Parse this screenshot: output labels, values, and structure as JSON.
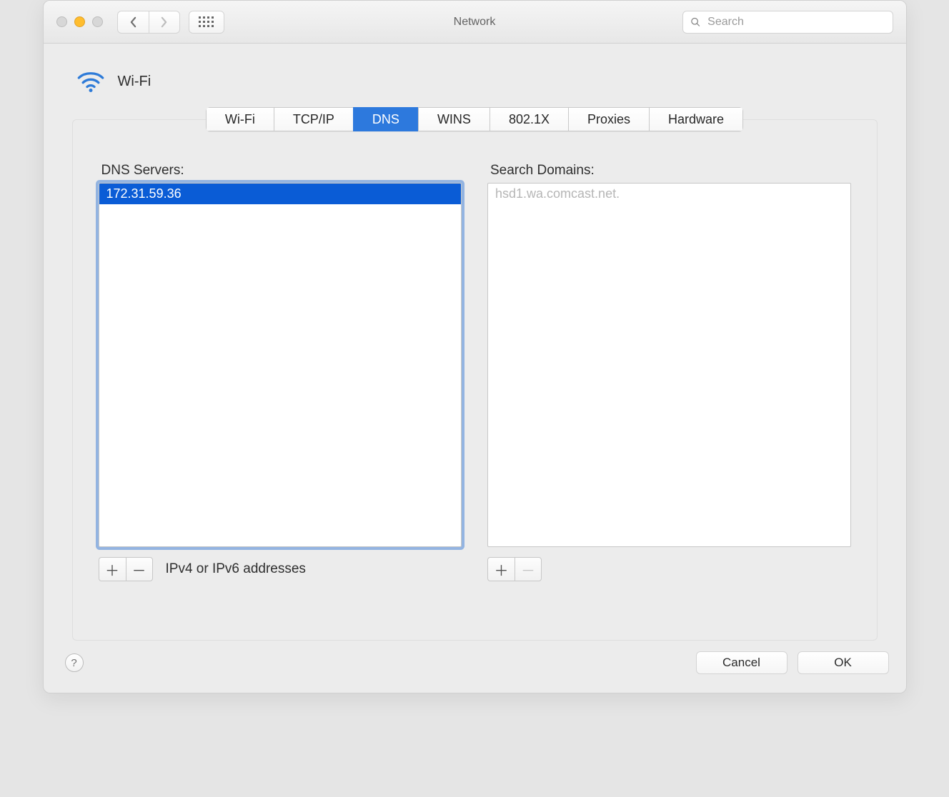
{
  "window": {
    "title": "Network"
  },
  "toolbar": {
    "search_placeholder": "Search"
  },
  "interface": {
    "name": "Wi-Fi"
  },
  "tabs": {
    "items": [
      "Wi-Fi",
      "TCP/IP",
      "DNS",
      "WINS",
      "802.1X",
      "Proxies",
      "Hardware"
    ],
    "active": "DNS"
  },
  "dns": {
    "servers_label": "DNS Servers:",
    "servers": [
      "172.31.59.36"
    ],
    "selected_index": 0,
    "hint": "IPv4 or IPv6 addresses"
  },
  "search_domains": {
    "label": "Search Domains:",
    "placeholder_items": [
      "hsd1.wa.comcast.net."
    ],
    "remove_disabled": true
  },
  "footer": {
    "cancel_label": "Cancel",
    "ok_label": "OK"
  }
}
